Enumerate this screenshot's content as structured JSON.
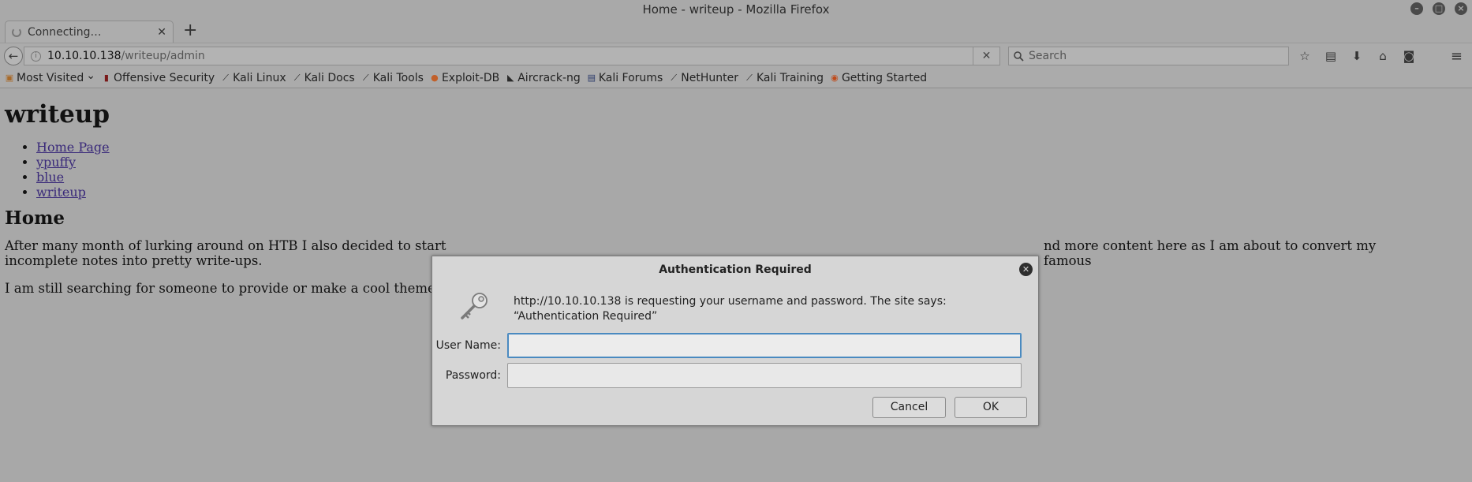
{
  "window": {
    "title": "Home - writeup - Mozilla Firefox"
  },
  "tab": {
    "title": "Connecting…"
  },
  "navbar": {
    "url_host": "10.10.10.138",
    "url_path": "/writeup/admin",
    "search_placeholder": "Search"
  },
  "bookmarks": [
    {
      "label": "Most Visited",
      "icon": "folder-icon"
    },
    {
      "label": "Offensive Security",
      "icon": "offsec-icon"
    },
    {
      "label": "Kali Linux",
      "icon": "kali-icon"
    },
    {
      "label": "Kali Docs",
      "icon": "kali-icon"
    },
    {
      "label": "Kali Tools",
      "icon": "kali-icon"
    },
    {
      "label": "Exploit-DB",
      "icon": "exploitdb-icon"
    },
    {
      "label": "Aircrack-ng",
      "icon": "aircrack-icon"
    },
    {
      "label": "Kali Forums",
      "icon": "forums-icon"
    },
    {
      "label": "NetHunter",
      "icon": "kali-icon"
    },
    {
      "label": "Kali Training",
      "icon": "kali-icon"
    },
    {
      "label": "Getting Started",
      "icon": "firefox-icon"
    }
  ],
  "page": {
    "title": "writeup",
    "nav_links": [
      "Home Page",
      "ypuffy",
      "blue",
      "writeup"
    ],
    "heading": "Home",
    "para1": "After many month of lurking around on HTB I also decided to start",
    "para1_right": "nd more content here as I am about to convert my famous",
    "para1_line2": "incomplete notes into pretty write-ups.",
    "para2": "I am still searching for someone to provide or make a cool theme. I"
  },
  "dialog": {
    "title": "Authentication Required",
    "message": "http://10.10.10.138 is requesting your username and password. The site says: “Authentication Required”",
    "username_label": "User Name:",
    "username_value": "",
    "password_label": "Password:",
    "password_value": "",
    "cancel_label": "Cancel",
    "ok_label": "OK"
  }
}
